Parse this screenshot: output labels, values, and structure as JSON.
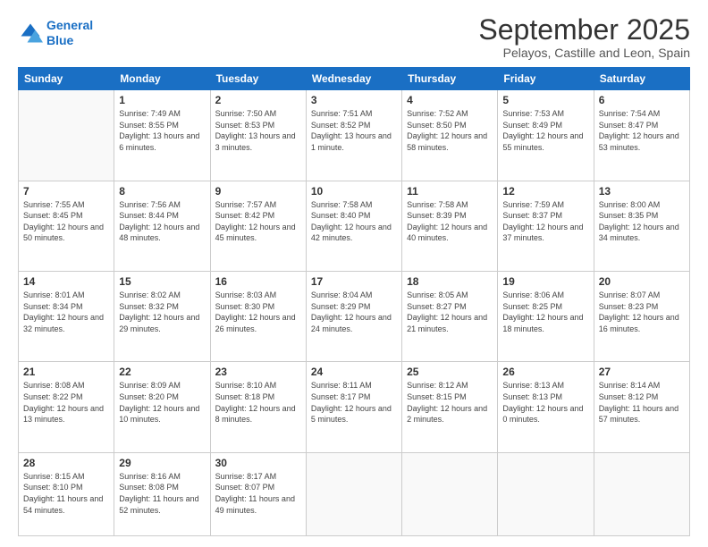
{
  "logo": {
    "line1": "General",
    "line2": "Blue"
  },
  "header": {
    "month": "September 2025",
    "location": "Pelayos, Castille and Leon, Spain"
  },
  "days": [
    "Sunday",
    "Monday",
    "Tuesday",
    "Wednesday",
    "Thursday",
    "Friday",
    "Saturday"
  ],
  "weeks": [
    [
      {
        "day": "",
        "empty": true
      },
      {
        "day": "1",
        "sunrise": "Sunrise: 7:49 AM",
        "sunset": "Sunset: 8:55 PM",
        "daylight": "Daylight: 13 hours and 6 minutes."
      },
      {
        "day": "2",
        "sunrise": "Sunrise: 7:50 AM",
        "sunset": "Sunset: 8:53 PM",
        "daylight": "Daylight: 13 hours and 3 minutes."
      },
      {
        "day": "3",
        "sunrise": "Sunrise: 7:51 AM",
        "sunset": "Sunset: 8:52 PM",
        "daylight": "Daylight: 13 hours and 1 minute."
      },
      {
        "day": "4",
        "sunrise": "Sunrise: 7:52 AM",
        "sunset": "Sunset: 8:50 PM",
        "daylight": "Daylight: 12 hours and 58 minutes."
      },
      {
        "day": "5",
        "sunrise": "Sunrise: 7:53 AM",
        "sunset": "Sunset: 8:49 PM",
        "daylight": "Daylight: 12 hours and 55 minutes."
      },
      {
        "day": "6",
        "sunrise": "Sunrise: 7:54 AM",
        "sunset": "Sunset: 8:47 PM",
        "daylight": "Daylight: 12 hours and 53 minutes."
      }
    ],
    [
      {
        "day": "7",
        "sunrise": "Sunrise: 7:55 AM",
        "sunset": "Sunset: 8:45 PM",
        "daylight": "Daylight: 12 hours and 50 minutes."
      },
      {
        "day": "8",
        "sunrise": "Sunrise: 7:56 AM",
        "sunset": "Sunset: 8:44 PM",
        "daylight": "Daylight: 12 hours and 48 minutes."
      },
      {
        "day": "9",
        "sunrise": "Sunrise: 7:57 AM",
        "sunset": "Sunset: 8:42 PM",
        "daylight": "Daylight: 12 hours and 45 minutes."
      },
      {
        "day": "10",
        "sunrise": "Sunrise: 7:58 AM",
        "sunset": "Sunset: 8:40 PM",
        "daylight": "Daylight: 12 hours and 42 minutes."
      },
      {
        "day": "11",
        "sunrise": "Sunrise: 7:58 AM",
        "sunset": "Sunset: 8:39 PM",
        "daylight": "Daylight: 12 hours and 40 minutes."
      },
      {
        "day": "12",
        "sunrise": "Sunrise: 7:59 AM",
        "sunset": "Sunset: 8:37 PM",
        "daylight": "Daylight: 12 hours and 37 minutes."
      },
      {
        "day": "13",
        "sunrise": "Sunrise: 8:00 AM",
        "sunset": "Sunset: 8:35 PM",
        "daylight": "Daylight: 12 hours and 34 minutes."
      }
    ],
    [
      {
        "day": "14",
        "sunrise": "Sunrise: 8:01 AM",
        "sunset": "Sunset: 8:34 PM",
        "daylight": "Daylight: 12 hours and 32 minutes."
      },
      {
        "day": "15",
        "sunrise": "Sunrise: 8:02 AM",
        "sunset": "Sunset: 8:32 PM",
        "daylight": "Daylight: 12 hours and 29 minutes."
      },
      {
        "day": "16",
        "sunrise": "Sunrise: 8:03 AM",
        "sunset": "Sunset: 8:30 PM",
        "daylight": "Daylight: 12 hours and 26 minutes."
      },
      {
        "day": "17",
        "sunrise": "Sunrise: 8:04 AM",
        "sunset": "Sunset: 8:29 PM",
        "daylight": "Daylight: 12 hours and 24 minutes."
      },
      {
        "day": "18",
        "sunrise": "Sunrise: 8:05 AM",
        "sunset": "Sunset: 8:27 PM",
        "daylight": "Daylight: 12 hours and 21 minutes."
      },
      {
        "day": "19",
        "sunrise": "Sunrise: 8:06 AM",
        "sunset": "Sunset: 8:25 PM",
        "daylight": "Daylight: 12 hours and 18 minutes."
      },
      {
        "day": "20",
        "sunrise": "Sunrise: 8:07 AM",
        "sunset": "Sunset: 8:23 PM",
        "daylight": "Daylight: 12 hours and 16 minutes."
      }
    ],
    [
      {
        "day": "21",
        "sunrise": "Sunrise: 8:08 AM",
        "sunset": "Sunset: 8:22 PM",
        "daylight": "Daylight: 12 hours and 13 minutes."
      },
      {
        "day": "22",
        "sunrise": "Sunrise: 8:09 AM",
        "sunset": "Sunset: 8:20 PM",
        "daylight": "Daylight: 12 hours and 10 minutes."
      },
      {
        "day": "23",
        "sunrise": "Sunrise: 8:10 AM",
        "sunset": "Sunset: 8:18 PM",
        "daylight": "Daylight: 12 hours and 8 minutes."
      },
      {
        "day": "24",
        "sunrise": "Sunrise: 8:11 AM",
        "sunset": "Sunset: 8:17 PM",
        "daylight": "Daylight: 12 hours and 5 minutes."
      },
      {
        "day": "25",
        "sunrise": "Sunrise: 8:12 AM",
        "sunset": "Sunset: 8:15 PM",
        "daylight": "Daylight: 12 hours and 2 minutes."
      },
      {
        "day": "26",
        "sunrise": "Sunrise: 8:13 AM",
        "sunset": "Sunset: 8:13 PM",
        "daylight": "Daylight: 12 hours and 0 minutes."
      },
      {
        "day": "27",
        "sunrise": "Sunrise: 8:14 AM",
        "sunset": "Sunset: 8:12 PM",
        "daylight": "Daylight: 11 hours and 57 minutes."
      }
    ],
    [
      {
        "day": "28",
        "sunrise": "Sunrise: 8:15 AM",
        "sunset": "Sunset: 8:10 PM",
        "daylight": "Daylight: 11 hours and 54 minutes."
      },
      {
        "day": "29",
        "sunrise": "Sunrise: 8:16 AM",
        "sunset": "Sunset: 8:08 PM",
        "daylight": "Daylight: 11 hours and 52 minutes."
      },
      {
        "day": "30",
        "sunrise": "Sunrise: 8:17 AM",
        "sunset": "Sunset: 8:07 PM",
        "daylight": "Daylight: 11 hours and 49 minutes."
      },
      {
        "day": "",
        "empty": true
      },
      {
        "day": "",
        "empty": true
      },
      {
        "day": "",
        "empty": true
      },
      {
        "day": "",
        "empty": true
      }
    ]
  ]
}
